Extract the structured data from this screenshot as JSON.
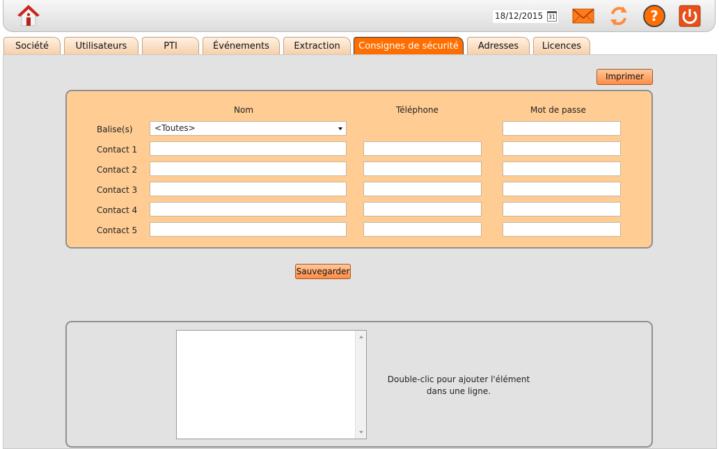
{
  "header": {
    "date": "18/12/2015",
    "calendar_day": "31",
    "icons": [
      "home-icon",
      "calendar-icon",
      "mail-icon",
      "refresh-icon",
      "help-icon",
      "power-icon"
    ]
  },
  "tabs": [
    {
      "label": "Société",
      "active": false
    },
    {
      "label": "Utilisateurs",
      "active": false
    },
    {
      "label": "PTI",
      "active": false
    },
    {
      "label": "Événements",
      "active": false
    },
    {
      "label": "Extraction",
      "active": false
    },
    {
      "label": "Consignes de sécurité",
      "active": true
    },
    {
      "label": "Adresses",
      "active": false
    },
    {
      "label": "Licences",
      "active": false
    }
  ],
  "toolbar": {
    "print_label": "Imprimer",
    "save_label": "Sauvegarder"
  },
  "form": {
    "col_name": "Nom",
    "col_phone": "Téléphone",
    "col_password": "Mot de passe",
    "balise_label": "Balise(s)",
    "balise_selected": "<Toutes>",
    "contacts": [
      {
        "label": "Contact 1",
        "name": "",
        "phone": "",
        "password": ""
      },
      {
        "label": "Contact 2",
        "name": "",
        "phone": "",
        "password": ""
      },
      {
        "label": "Contact 3",
        "name": "",
        "phone": "",
        "password": ""
      },
      {
        "label": "Contact 4",
        "name": "",
        "phone": "",
        "password": ""
      },
      {
        "label": "Contact 5",
        "name": "",
        "phone": "",
        "password": ""
      }
    ]
  },
  "bottom": {
    "hint": "Double-clic pour ajouter l'élément dans une ligne."
  },
  "colors": {
    "accent": "#ff6e00",
    "panel": "#ffcc93",
    "background": "#e2e2e2"
  }
}
